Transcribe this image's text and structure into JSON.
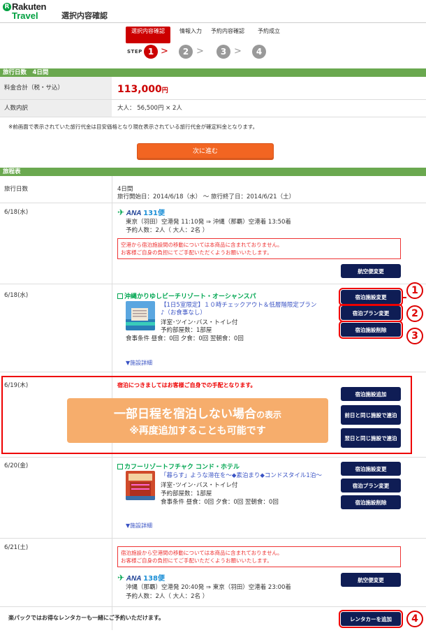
{
  "header": {
    "logo_mark": "R",
    "logo_top": "Rakuten",
    "logo_bottom": "Travel",
    "page_title": "選択内容確認"
  },
  "steps": {
    "word": "STEP",
    "items": [
      {
        "num": "1",
        "label": "選択内容確認",
        "active": true
      },
      {
        "num": "2",
        "label": "情報入力"
      },
      {
        "num": "3",
        "label": "予約内容確認"
      },
      {
        "num": "4",
        "label": "予約成立"
      }
    ]
  },
  "summary": {
    "bar": "旅行日数　4日間",
    "total_label": "料金合計（税・サ込）",
    "total_value": "113,000",
    "total_unit": "円",
    "people_label": "人数内訳",
    "people_value": "大人：  56,500円 ×  2人",
    "note": "※前画面で表示されていた旅行代金は目安価格となり現在表示されている旅行代金が確定料金となります。",
    "next_button": "次に進む"
  },
  "itinerary": {
    "bar": "旅程表",
    "days_label": "旅行日数",
    "days_value": "4日間",
    "period": "旅行開始日：2014/6/18（水） 〜  旅行終了日：2014/6/21（土）",
    "flight1": {
      "date": "6/18(水)",
      "airline": "ANA",
      "flight_no": "131便",
      "route": "東京（羽田）空港発  11:10発 ⇒ 沖縄（那覇）空港着  13:50着",
      "pax": "予約人数：2人（ 大人：2名 ）",
      "warning1": "空港から宿泊施設間の移動については本商品に含まれておりません。",
      "warning2": "お客様ご自身の負担にてご手配いただくようお願いいたします。",
      "button": "航空便変更"
    },
    "hotel1": {
      "date": "6/18(水)",
      "name": "沖縄かりゆしビーチリゾート・オーシャンスパ",
      "plan1": "【1日5室限定】１０時チェックアウト＆低層階限定プラン",
      "plan2": "♪（お食事なし）",
      "room": "洋室･ツイン･バス・トイレ付",
      "rooms": "予約部屋数：1部屋",
      "meals": "食事条件   昼食：0回   夕食：0回   翌朝食：0回",
      "detail": "▼施設詳細",
      "btn_change": "宿泊施設変更",
      "btn_plan": "宿泊プラン変更",
      "btn_delete": "宿泊施設削除"
    },
    "noStay": {
      "date": "6/19(木)",
      "notice": "宿泊につきましてはお客様ご自身での手配となります。",
      "overlay_line1_main": "一部日程を宿泊しない場合",
      "overlay_line1_small": "の表示",
      "overlay_line2": "※再度追加することも可能です",
      "btn_add": "宿泊施設追加",
      "btn_prev": "前日と同じ施設で連泊",
      "btn_next": "翌日と同じ施設で連泊"
    },
    "hotel2": {
      "date": "6/20(金)",
      "name": "カフーリゾートフチャク  コンド・ホテル",
      "plan1": "「暮らす」ような滞在を〜◆素泊まり◆コンドスタイル1泊〜",
      "room": "洋室･ツイン･バス・トイレ付",
      "rooms": "予約部屋数：1部屋",
      "meals": "食事条件   昼食：0回   夕食：0回   翌朝食：0回",
      "detail": "▼施設詳細",
      "btn_change": "宿泊施設変更",
      "btn_plan": "宿泊プラン変更",
      "btn_delete": "宿泊施設削除"
    },
    "flight2": {
      "date": "6/21(土)",
      "warning1": "宿泊施設から空港間の移動については本商品に含まれておりません。",
      "warning2": "お客様ご自身の負担にてご手配いただくようお願いいたします。",
      "airline": "ANA",
      "flight_no": "138便",
      "route": "沖縄（那覇）空港発  20:40発 ⇒ 東京（羽田）空港着  23:00着",
      "pax": "予約人数：2人（ 大人：2名 ）",
      "button": "航空便変更"
    },
    "rental": {
      "text": "楽パックではお得なレンタカーも一緒にご予約いただけます。",
      "button": "レンタカーを追加"
    }
  },
  "callouts": [
    "1",
    "2",
    "3",
    "4"
  ],
  "colors": {
    "section_green": "#6aa84f",
    "price_red": "#cc0000",
    "button_navy": "#0f1d55",
    "next_orange": "#f26522",
    "overlay_orange": "#f6ad6c",
    "highlight_red": "#ee0000"
  }
}
